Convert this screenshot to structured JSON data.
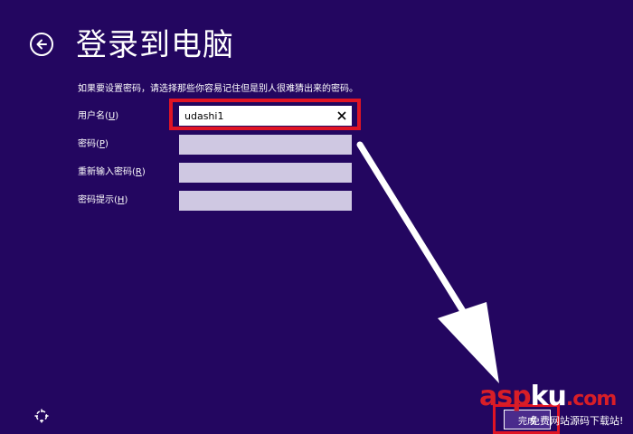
{
  "header": {
    "back_icon": "back-arrow-icon",
    "title": "登录到电脑"
  },
  "instruction": "如果要设置密码，请选择那些你容易记住但是别人很难猜出来的密码。",
  "form": {
    "username": {
      "label": "用户名",
      "access_key": "U",
      "value": "udashi1",
      "clear_icon": "clear-x-icon"
    },
    "password": {
      "label": "密码",
      "access_key": "P",
      "value": ""
    },
    "confirm_password": {
      "label": "重新输入密码",
      "access_key": "R",
      "value": ""
    },
    "password_hint": {
      "label": "密码提示",
      "access_key": "H",
      "value": ""
    }
  },
  "footer": {
    "ease_of_access_icon": "ease-of-access-icon",
    "finish_label": "完成"
  },
  "watermark": {
    "logo_asp": "asp",
    "logo_ku": "ku",
    "logo_com": ".com",
    "subtitle": "免费网站源码下载站!"
  },
  "colors": {
    "background": "#230660",
    "highlight": "#e01424",
    "input_inactive": "#cfc8e2",
    "arrow": "#ffffff"
  }
}
